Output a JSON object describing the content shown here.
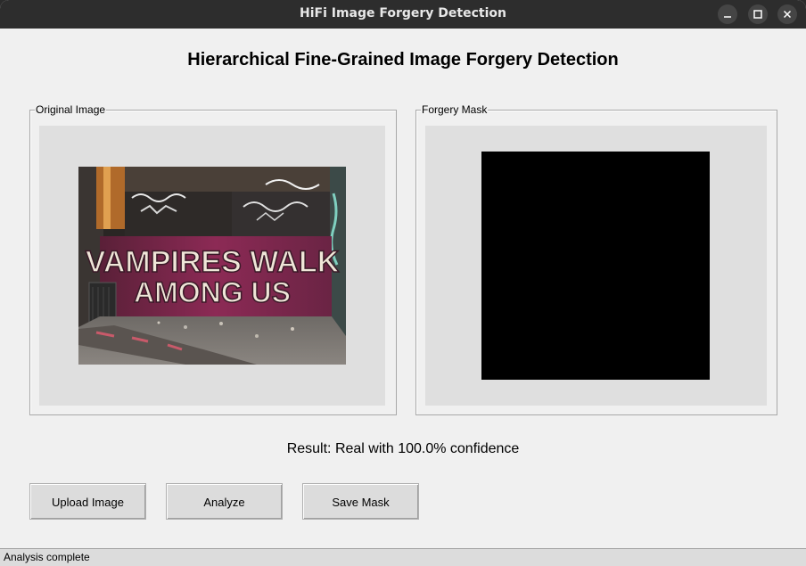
{
  "window": {
    "title": "HiFi Image Forgery Detection"
  },
  "main": {
    "heading": "Hierarchical Fine-Grained Image Forgery Detection",
    "original_panel": {
      "label": "Original Image",
      "image_text_line1": "VAMPIRES WALK",
      "image_text_line2": "AMONG US"
    },
    "mask_panel": {
      "label": "Forgery Mask"
    },
    "result_text": "Result: Real with 100.0% confidence"
  },
  "buttons": {
    "upload_label": "Upload Image",
    "analyze_label": "Analyze",
    "save_label": "Save Mask"
  },
  "status": {
    "text": "Analysis complete"
  },
  "colors": {
    "titlebar": "#2d2d2d",
    "window_bg": "#f0f0f0",
    "canvas_bg": "#dfdfdf",
    "mask": "#000000",
    "graffiti_wall": "#8c2a55"
  }
}
